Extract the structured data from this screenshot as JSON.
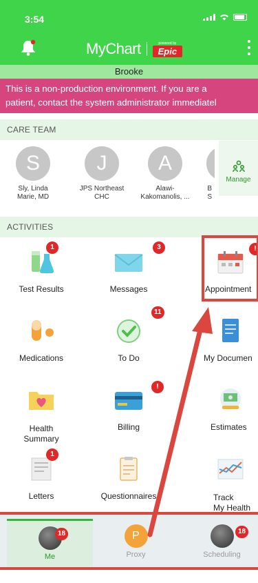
{
  "status_bar": {
    "time": "3:54"
  },
  "header": {
    "app_name": "MyChart",
    "powered_by": "powered by",
    "vendor": "Epic"
  },
  "patient": {
    "name": "Brooke"
  },
  "warning": {
    "line1": "This is a non-production environment. If you are a",
    "line2": "patient, contact the system administrator immediatel"
  },
  "care_team": {
    "title": "CARE TEAM",
    "members": [
      {
        "initial": "S",
        "name_l1": "Sly, Linda",
        "name_l2": "Marie, MD"
      },
      {
        "initial": "J",
        "name_l1": "JPS Northeast",
        "name_l2": "CHC"
      },
      {
        "initial": "A",
        "name_l1": "Alawi-",
        "name_l2": "Kakomanolis, ..."
      },
      {
        "initial": "",
        "name_l1": "B",
        "name_l2": "S"
      }
    ],
    "manage_label": "Manage"
  },
  "activities": {
    "title": "ACTIVITIES",
    "tiles": [
      {
        "label": "Test Results",
        "badge": "1"
      },
      {
        "label": "Messages",
        "badge": "3"
      },
      {
        "label": "Appointment",
        "badge": "!"
      },
      {
        "label": "Medications",
        "badge": ""
      },
      {
        "label": "To Do",
        "badge": "11"
      },
      {
        "label": "My Documen",
        "badge": ""
      },
      {
        "label_l1": "Health",
        "label_l2": "Summary",
        "badge": ""
      },
      {
        "label": "Billing",
        "badge": "!"
      },
      {
        "label": "Estimates",
        "badge": ""
      },
      {
        "label": "Letters",
        "badge": "1"
      },
      {
        "label": "Questionnaires",
        "badge": ""
      },
      {
        "label_l1": "Track",
        "label_l2": "My Health",
        "badge": ""
      }
    ]
  },
  "tabbar": {
    "tabs": [
      {
        "label": "Me",
        "badge": "18"
      },
      {
        "label": "Proxy",
        "initial": "P"
      },
      {
        "label": "Scheduling",
        "badge": "18"
      }
    ]
  },
  "colors": {
    "brand_green": "#3fd44a",
    "warning_pink": "#d6457d",
    "annotation_red": "#d9473f",
    "badge_red": "#e02828"
  }
}
